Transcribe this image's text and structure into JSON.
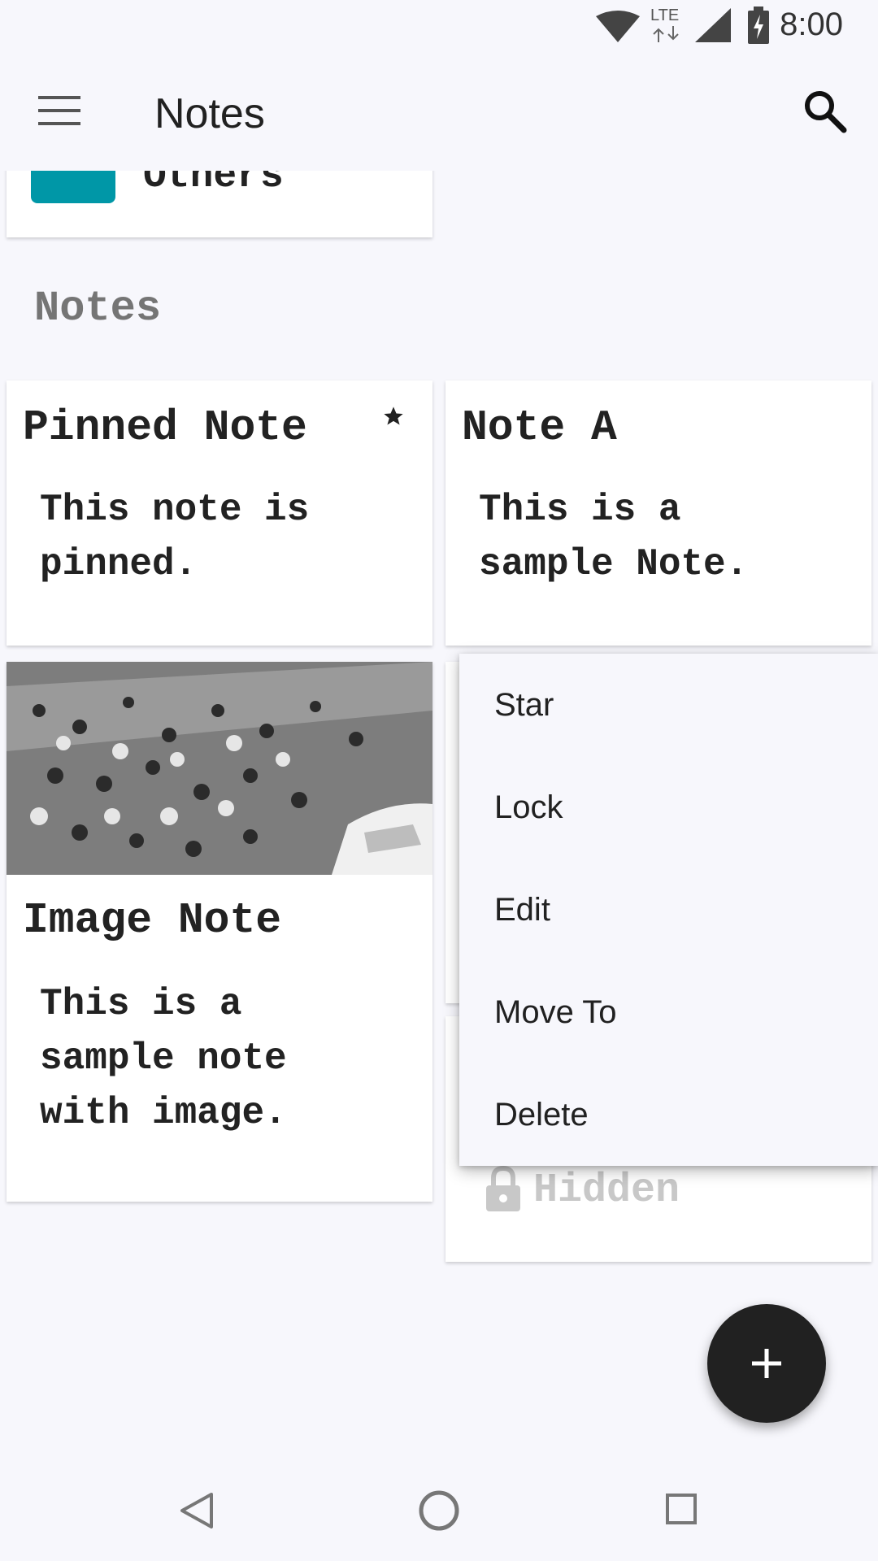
{
  "status_bar": {
    "time": "8:00",
    "network_label": "LTE",
    "icons": [
      "wifi-icon",
      "cellular-signal-icon",
      "battery-charging-icon"
    ]
  },
  "app_bar": {
    "title": "Notes",
    "menu_icon": "hamburger-menu-icon",
    "search_icon": "search-icon"
  },
  "folder_card": {
    "label": "Others",
    "color": "#0097a7"
  },
  "section": {
    "title": "Notes"
  },
  "notes": [
    {
      "title": "Pinned Note",
      "body": "This note is pinned.",
      "starred": true
    },
    {
      "title": "Note A",
      "body": "This is a sample Note."
    },
    {
      "title": "Image Note",
      "body": "This is a sample note with image.",
      "has_image": true
    },
    {
      "title": "",
      "body": "Hidden",
      "locked": true
    }
  ],
  "context_menu": {
    "items": [
      "Star",
      "Lock",
      "Edit",
      "Move To",
      "Delete"
    ]
  },
  "fab": {
    "icon": "plus-icon"
  },
  "nav_bar": {
    "icons": [
      "back-icon",
      "home-icon",
      "recents-icon"
    ]
  },
  "colors": {
    "background": "#f7f7fc",
    "folder_accent": "#0097a7",
    "fab": "#212121"
  }
}
